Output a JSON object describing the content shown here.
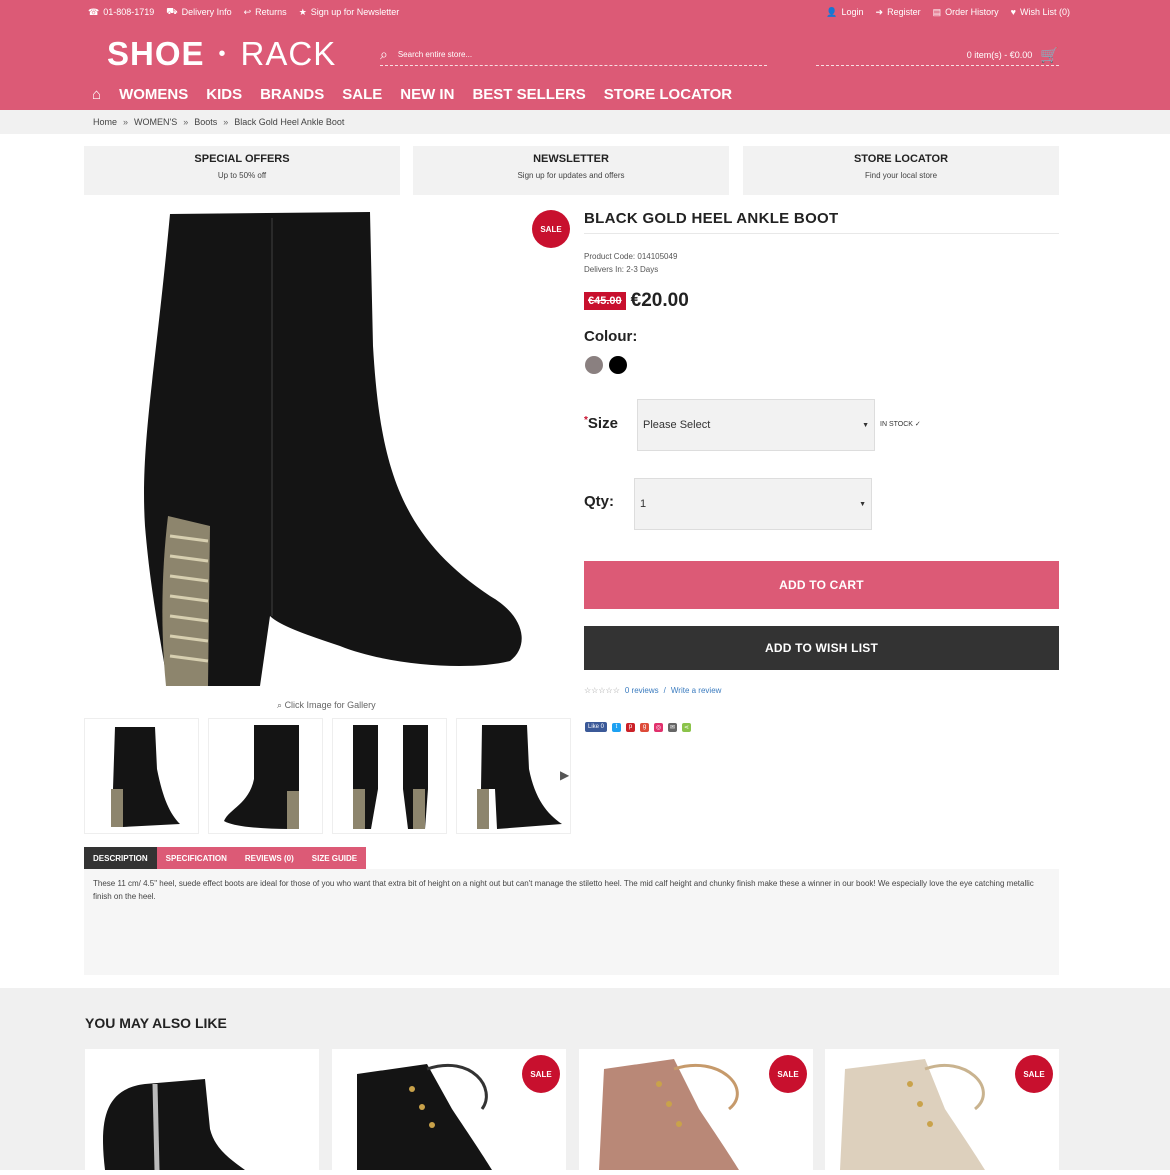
{
  "topbar": {
    "phone": "01-808-1719",
    "delivery": "Delivery Info",
    "returns": "Returns",
    "newsletter": "Sign up for Newsletter",
    "login": "Login",
    "register": "Register",
    "order_history": "Order History",
    "wish_list": "Wish List (0)"
  },
  "logo": {
    "part1": "SHOE",
    "sep": "•",
    "part2": "RACK"
  },
  "search": {
    "placeholder": "Search entire store..."
  },
  "cart": {
    "label": "0 item(s) - €0.00"
  },
  "nav": [
    "WOMENS",
    "KIDS",
    "BRANDS",
    "SALE",
    "NEW IN",
    "BEST SELLERS",
    "STORE LOCATOR"
  ],
  "breadcrumb": [
    "Home",
    "WOMEN'S",
    "Boots",
    "Black Gold Heel Ankle Boot"
  ],
  "breadcrumb_sep": "»",
  "promos": [
    {
      "title": "SPECIAL OFFERS",
      "sub": "Up to 50% off"
    },
    {
      "title": "NEWSLETTER",
      "sub": "Sign up for updates and offers"
    },
    {
      "title": "STORE LOCATOR",
      "sub": "Find your local store"
    }
  ],
  "sale_badge": "SALE",
  "gallery_hint": "Click Image for Gallery",
  "product": {
    "title": "BLACK GOLD HEEL ANKLE BOOT",
    "code": "Product Code: 014105049",
    "delivers": "Delivers In: 2-3 Days",
    "old_price": "€45.00",
    "price": "€20.00",
    "colour_label": "Colour:",
    "colours": [
      "#8a8080",
      "#000000"
    ],
    "size_label": "Size",
    "size_value": "Please Select",
    "stock": "IN STOCK ✓",
    "qty_label": "Qty:",
    "qty_value": "1",
    "add_to_cart": "ADD TO CART",
    "add_to_wishlist": "ADD TO WISH LIST",
    "stars": "☆☆☆☆☆",
    "reviews_link": "0 reviews",
    "write_review": "Write a review",
    "review_sep": "/",
    "like": "Like 0"
  },
  "tabs": [
    "DESCRIPTION",
    "SPECIFICATION",
    "REVIEWS (0)",
    "SIZE GUIDE"
  ],
  "description": "These 11 cm/ 4.5\" heel, suede effect  boots are ideal for those of you who want that extra bit of height on a night out but can't manage the stiletto heel. The mid calf height and chunky finish make these a winner in our book! We especially love the eye catching metallic finish on the heel.",
  "also_like": {
    "title": "YOU MAY ALSO LIKE"
  },
  "colors": {
    "brand": "#dc5a76",
    "sale": "#c8102e",
    "dark": "#333333"
  }
}
